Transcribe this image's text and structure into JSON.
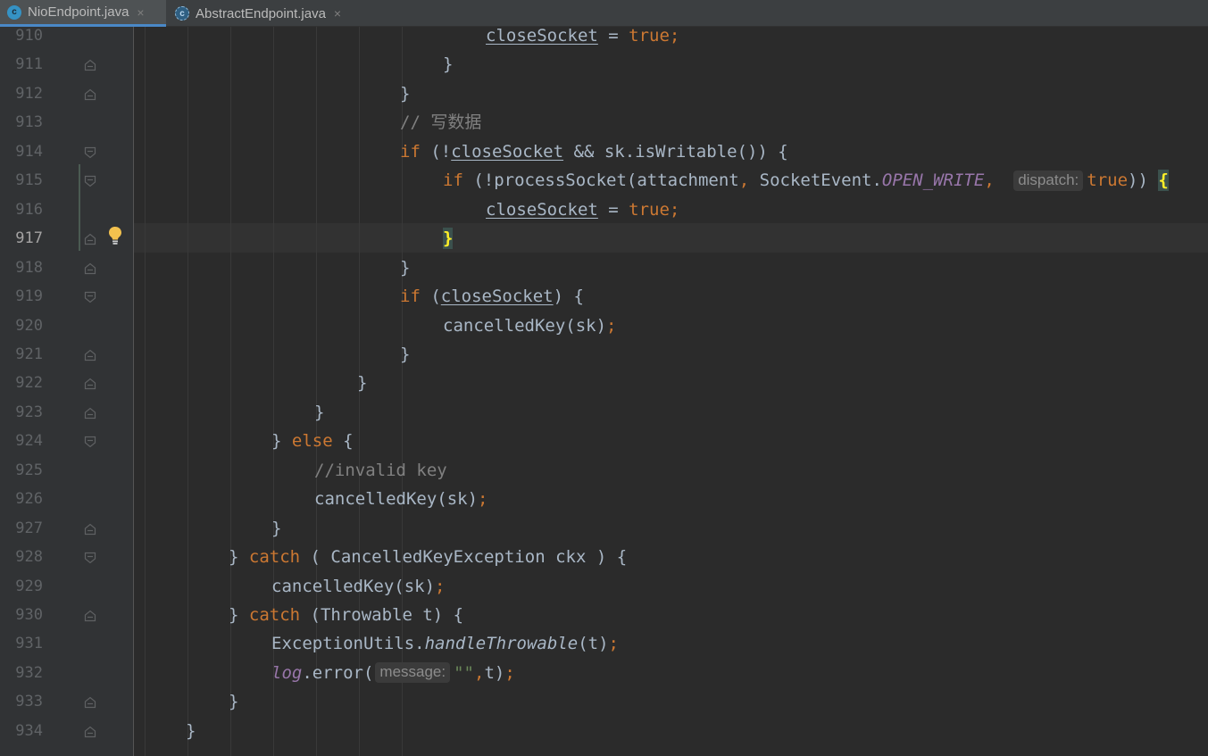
{
  "tabs": [
    {
      "icon": "class-icon",
      "icon_letter": "c",
      "label": "NioEndpoint.java",
      "active": true,
      "close": "×"
    },
    {
      "icon": "abstract-class-icon",
      "icon_letter": "c",
      "label": "AbstractEndpoint.java",
      "active": false,
      "close": "×"
    }
  ],
  "current_line": "917",
  "lines": [
    {
      "no": "910",
      "col": 6,
      "fold": "none",
      "tokens": [
        {
          "t": "v",
          "s": "closeSocket"
        },
        {
          "t": "p",
          "s": " = "
        },
        {
          "t": "kw",
          "s": "true;"
        }
      ]
    },
    {
      "no": "911",
      "col": 5,
      "fold": "end",
      "tokens": [
        {
          "t": "p",
          "s": "}"
        }
      ]
    },
    {
      "no": "912",
      "col": 4,
      "fold": "end",
      "tokens": [
        {
          "t": "p",
          "s": "}"
        }
      ]
    },
    {
      "no": "913",
      "col": 4,
      "fold": "none",
      "tokens": [
        {
          "t": "cm",
          "s": "// 写数据"
        }
      ]
    },
    {
      "no": "914",
      "col": 4,
      "fold": "start",
      "tokens": [
        {
          "t": "kw",
          "s": "if "
        },
        {
          "t": "p",
          "s": "(!"
        },
        {
          "t": "v",
          "s": "closeSocket"
        },
        {
          "t": "p",
          "s": " && sk.isWritable()) {"
        }
      ]
    },
    {
      "no": "915",
      "col": 5,
      "fold": "start",
      "tokens": [
        {
          "t": "kw",
          "s": "if "
        },
        {
          "t": "p",
          "s": "(!processSocket(attachment"
        },
        {
          "t": "kw",
          "s": ", "
        },
        {
          "t": "p",
          "s": "SocketEvent."
        },
        {
          "t": "cn",
          "s": "OPEN_WRITE"
        },
        {
          "t": "kw",
          "s": ", "
        },
        {
          "t": "hint",
          "s": "dispatch:"
        },
        {
          "t": "kw",
          "s": "true"
        },
        {
          "t": "p",
          "s": ")) "
        },
        {
          "t": "brace-hl",
          "s": "{"
        }
      ]
    },
    {
      "no": "916",
      "col": 6,
      "fold": "none",
      "tokens": [
        {
          "t": "v",
          "s": "closeSocket"
        },
        {
          "t": "p",
          "s": " = "
        },
        {
          "t": "kw",
          "s": "true;"
        }
      ]
    },
    {
      "no": "917",
      "col": 5,
      "fold": "end",
      "tokens": [
        {
          "t": "brace-hl",
          "s": "}"
        }
      ]
    },
    {
      "no": "918",
      "col": 4,
      "fold": "end",
      "tokens": [
        {
          "t": "p",
          "s": "}"
        }
      ]
    },
    {
      "no": "919",
      "col": 4,
      "fold": "start",
      "tokens": [
        {
          "t": "kw",
          "s": "if "
        },
        {
          "t": "p",
          "s": "("
        },
        {
          "t": "v",
          "s": "closeSocket"
        },
        {
          "t": "p",
          "s": ") {"
        }
      ]
    },
    {
      "no": "920",
      "col": 5,
      "fold": "none",
      "tokens": [
        {
          "t": "p",
          "s": "cancelledKey(sk)"
        },
        {
          "t": "kw",
          "s": ";"
        }
      ]
    },
    {
      "no": "921",
      "col": 4,
      "fold": "end",
      "tokens": [
        {
          "t": "p",
          "s": "}"
        }
      ]
    },
    {
      "no": "922",
      "col": 3,
      "fold": "end",
      "tokens": [
        {
          "t": "p",
          "s": "}"
        }
      ]
    },
    {
      "no": "923",
      "col": 2,
      "fold": "end",
      "tokens": [
        {
          "t": "p",
          "s": "}"
        }
      ]
    },
    {
      "no": "924",
      "col": 1,
      "fold": "start",
      "tokens": [
        {
          "t": "p",
          "s": "} "
        },
        {
          "t": "kw",
          "s": "else "
        },
        {
          "t": "p",
          "s": "{"
        }
      ]
    },
    {
      "no": "925",
      "col": 2,
      "fold": "none",
      "tokens": [
        {
          "t": "cm",
          "s": "//invalid key"
        }
      ]
    },
    {
      "no": "926",
      "col": 2,
      "fold": "none",
      "tokens": [
        {
          "t": "p",
          "s": "cancelledKey(sk)"
        },
        {
          "t": "kw",
          "s": ";"
        }
      ]
    },
    {
      "no": "927",
      "col": 1,
      "fold": "end",
      "tokens": [
        {
          "t": "p",
          "s": "}"
        }
      ]
    },
    {
      "no": "928",
      "col": 0,
      "fold": "start",
      "tokens": [
        {
          "t": "p",
          "s": "} "
        },
        {
          "t": "kw",
          "s": "catch "
        },
        {
          "t": "p",
          "s": "( CancelledKeyException ckx ) {"
        }
      ]
    },
    {
      "no": "929",
      "col": 1,
      "fold": "none",
      "tokens": [
        {
          "t": "p",
          "s": "cancelledKey(sk)"
        },
        {
          "t": "kw",
          "s": ";"
        }
      ]
    },
    {
      "no": "930",
      "col": 0,
      "fold": "end",
      "tokens": [
        {
          "t": "p",
          "s": "} "
        },
        {
          "t": "kw",
          "s": "catch "
        },
        {
          "t": "p",
          "s": "(Throwable t) {"
        }
      ]
    },
    {
      "no": "931",
      "col": 1,
      "fold": "none",
      "tokens": [
        {
          "t": "p",
          "s": "ExceptionUtils."
        },
        {
          "t": "sm",
          "s": "handleThrowable"
        },
        {
          "t": "p",
          "s": "(t)"
        },
        {
          "t": "kw",
          "s": ";"
        }
      ]
    },
    {
      "no": "932",
      "col": 1,
      "fold": "none",
      "tokens": [
        {
          "t": "fi",
          "s": "log"
        },
        {
          "t": "p",
          "s": ".error("
        },
        {
          "t": "hint-m",
          "s": "message:"
        },
        {
          "t": "str",
          "s": "\"\""
        },
        {
          "t": "kw",
          "s": ","
        },
        {
          "t": "p",
          "s": "t)"
        },
        {
          "t": "kw",
          "s": ";"
        }
      ]
    },
    {
      "no": "933",
      "col": 0,
      "fold": "end",
      "tokens": [
        {
          "t": "p",
          "s": "}"
        }
      ]
    },
    {
      "no": "934",
      "col": -1,
      "fold": "end",
      "tokens": [
        {
          "t": "p",
          "s": "}"
        }
      ]
    }
  ]
}
